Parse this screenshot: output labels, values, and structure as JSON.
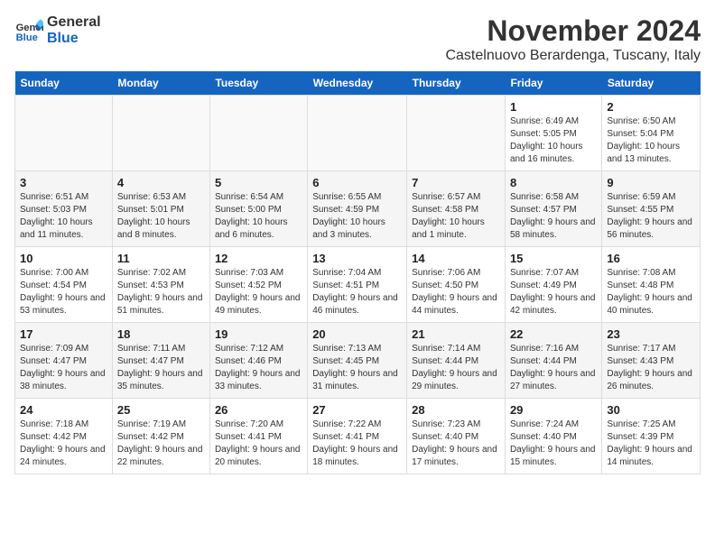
{
  "header": {
    "logo_line1": "General",
    "logo_line2": "Blue",
    "month": "November 2024",
    "location": "Castelnuovo Berardenga, Tuscany, Italy"
  },
  "weekdays": [
    "Sunday",
    "Monday",
    "Tuesday",
    "Wednesday",
    "Thursday",
    "Friday",
    "Saturday"
  ],
  "weeks": [
    [
      {
        "day": "",
        "info": ""
      },
      {
        "day": "",
        "info": ""
      },
      {
        "day": "",
        "info": ""
      },
      {
        "day": "",
        "info": ""
      },
      {
        "day": "",
        "info": ""
      },
      {
        "day": "1",
        "info": "Sunrise: 6:49 AM\nSunset: 5:05 PM\nDaylight: 10 hours and 16 minutes."
      },
      {
        "day": "2",
        "info": "Sunrise: 6:50 AM\nSunset: 5:04 PM\nDaylight: 10 hours and 13 minutes."
      }
    ],
    [
      {
        "day": "3",
        "info": "Sunrise: 6:51 AM\nSunset: 5:03 PM\nDaylight: 10 hours and 11 minutes."
      },
      {
        "day": "4",
        "info": "Sunrise: 6:53 AM\nSunset: 5:01 PM\nDaylight: 10 hours and 8 minutes."
      },
      {
        "day": "5",
        "info": "Sunrise: 6:54 AM\nSunset: 5:00 PM\nDaylight: 10 hours and 6 minutes."
      },
      {
        "day": "6",
        "info": "Sunrise: 6:55 AM\nSunset: 4:59 PM\nDaylight: 10 hours and 3 minutes."
      },
      {
        "day": "7",
        "info": "Sunrise: 6:57 AM\nSunset: 4:58 PM\nDaylight: 10 hours and 1 minute."
      },
      {
        "day": "8",
        "info": "Sunrise: 6:58 AM\nSunset: 4:57 PM\nDaylight: 9 hours and 58 minutes."
      },
      {
        "day": "9",
        "info": "Sunrise: 6:59 AM\nSunset: 4:55 PM\nDaylight: 9 hours and 56 minutes."
      }
    ],
    [
      {
        "day": "10",
        "info": "Sunrise: 7:00 AM\nSunset: 4:54 PM\nDaylight: 9 hours and 53 minutes."
      },
      {
        "day": "11",
        "info": "Sunrise: 7:02 AM\nSunset: 4:53 PM\nDaylight: 9 hours and 51 minutes."
      },
      {
        "day": "12",
        "info": "Sunrise: 7:03 AM\nSunset: 4:52 PM\nDaylight: 9 hours and 49 minutes."
      },
      {
        "day": "13",
        "info": "Sunrise: 7:04 AM\nSunset: 4:51 PM\nDaylight: 9 hours and 46 minutes."
      },
      {
        "day": "14",
        "info": "Sunrise: 7:06 AM\nSunset: 4:50 PM\nDaylight: 9 hours and 44 minutes."
      },
      {
        "day": "15",
        "info": "Sunrise: 7:07 AM\nSunset: 4:49 PM\nDaylight: 9 hours and 42 minutes."
      },
      {
        "day": "16",
        "info": "Sunrise: 7:08 AM\nSunset: 4:48 PM\nDaylight: 9 hours and 40 minutes."
      }
    ],
    [
      {
        "day": "17",
        "info": "Sunrise: 7:09 AM\nSunset: 4:47 PM\nDaylight: 9 hours and 38 minutes."
      },
      {
        "day": "18",
        "info": "Sunrise: 7:11 AM\nSunset: 4:47 PM\nDaylight: 9 hours and 35 minutes."
      },
      {
        "day": "19",
        "info": "Sunrise: 7:12 AM\nSunset: 4:46 PM\nDaylight: 9 hours and 33 minutes."
      },
      {
        "day": "20",
        "info": "Sunrise: 7:13 AM\nSunset: 4:45 PM\nDaylight: 9 hours and 31 minutes."
      },
      {
        "day": "21",
        "info": "Sunrise: 7:14 AM\nSunset: 4:44 PM\nDaylight: 9 hours and 29 minutes."
      },
      {
        "day": "22",
        "info": "Sunrise: 7:16 AM\nSunset: 4:44 PM\nDaylight: 9 hours and 27 minutes."
      },
      {
        "day": "23",
        "info": "Sunrise: 7:17 AM\nSunset: 4:43 PM\nDaylight: 9 hours and 26 minutes."
      }
    ],
    [
      {
        "day": "24",
        "info": "Sunrise: 7:18 AM\nSunset: 4:42 PM\nDaylight: 9 hours and 24 minutes."
      },
      {
        "day": "25",
        "info": "Sunrise: 7:19 AM\nSunset: 4:42 PM\nDaylight: 9 hours and 22 minutes."
      },
      {
        "day": "26",
        "info": "Sunrise: 7:20 AM\nSunset: 4:41 PM\nDaylight: 9 hours and 20 minutes."
      },
      {
        "day": "27",
        "info": "Sunrise: 7:22 AM\nSunset: 4:41 PM\nDaylight: 9 hours and 18 minutes."
      },
      {
        "day": "28",
        "info": "Sunrise: 7:23 AM\nSunset: 4:40 PM\nDaylight: 9 hours and 17 minutes."
      },
      {
        "day": "29",
        "info": "Sunrise: 7:24 AM\nSunset: 4:40 PM\nDaylight: 9 hours and 15 minutes."
      },
      {
        "day": "30",
        "info": "Sunrise: 7:25 AM\nSunset: 4:39 PM\nDaylight: 9 hours and 14 minutes."
      }
    ]
  ]
}
